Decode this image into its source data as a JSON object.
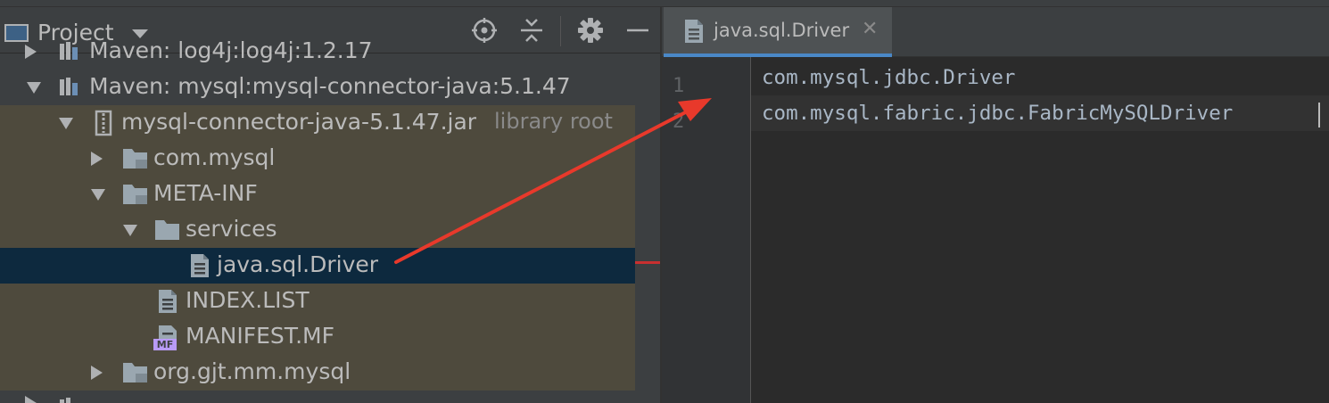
{
  "project_panel": {
    "title": "Project",
    "header_buttons": [
      "locate-icon",
      "collapse-all-icon",
      "gear-icon",
      "minimize-icon"
    ]
  },
  "tree": {
    "rows": [
      {
        "label": "Maven: log4j:log4j:1.2.17"
      },
      {
        "label": "Maven: mysql:mysql-connector-java:5.1.47"
      },
      {
        "label": "mysql-connector-java-5.1.47.jar",
        "suffix": "library root"
      },
      {
        "label": "com.mysql"
      },
      {
        "label": "META-INF"
      },
      {
        "label": "services"
      },
      {
        "label": "java.sql.Driver"
      },
      {
        "label": "INDEX.LIST"
      },
      {
        "label": "MANIFEST.MF"
      },
      {
        "label": "org.gjt.mm.mysql"
      }
    ],
    "manifest_badge": "MF"
  },
  "editor": {
    "tab": {
      "label": "java.sql.Driver",
      "close": "✕"
    },
    "lines": [
      {
        "number": "1",
        "text": "com.mysql.jdbc.Driver"
      },
      {
        "number": "2",
        "text": "com.mysql.fabric.jdbc.FabricMySQLDriver"
      }
    ]
  },
  "colors": {
    "annotation_arrow": "#e8392b",
    "selection": "#0d293e",
    "library_bg": "#4e4a3d",
    "tab_underline": "#4a88c7"
  }
}
